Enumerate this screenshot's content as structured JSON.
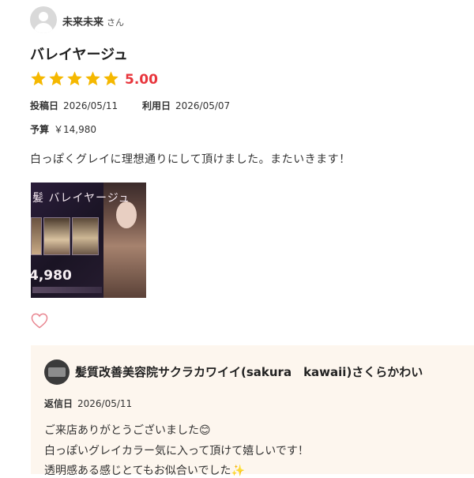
{
  "review": {
    "user_name": "未来未来",
    "user_suffix": "さん",
    "title": "バレイヤージュ",
    "rating": "5.00",
    "star_count": 5,
    "posted_label": "投稿日",
    "posted_date": "2026/05/11",
    "used_label": "利用日",
    "used_date": "2026/05/07",
    "budget_label": "予算",
    "budget_value": "￥14,980",
    "body": "白っぽくグレイに理想通りにして頂けました。またいきます！",
    "photo": {
      "title": "髪 バレイヤージュ",
      "price": "4,980"
    }
  },
  "reply": {
    "salon_name": "髪質改善美容院サクラカワイイ(sakura　kawaii)さくらかわい",
    "date_label": "返信日",
    "date": "2026/05/11",
    "lines": [
      "ご来店ありがとうございました😊",
      "白っぽいグレイカラー気に入って頂けて嬉しいです！",
      "透明感ある感じとてもお似合いでした✨"
    ]
  },
  "colors": {
    "star": "#f5b800",
    "rating": "#e8353c",
    "heart": "#e8838e",
    "reply_bg": "#fdf6ee"
  }
}
